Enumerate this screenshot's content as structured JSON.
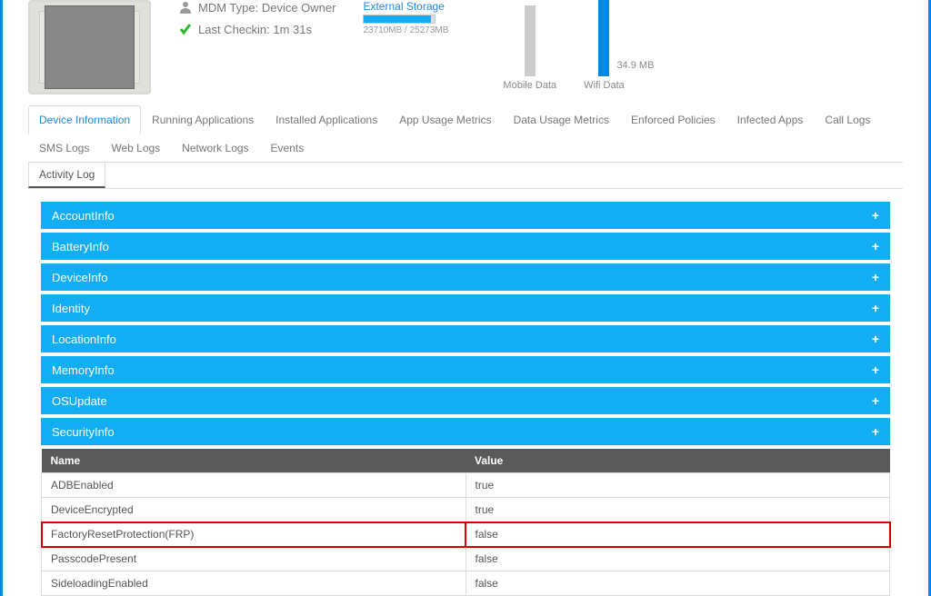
{
  "device": {
    "mdm_type_label": "MDM Type: Device Owner",
    "last_checkin_label": "Last Checkin: 1m 31s"
  },
  "storage": {
    "label": "External Storage",
    "fill_percent": 94,
    "text": "23710MB / 25273MB"
  },
  "mobile_data": {
    "label": "Mobile Data"
  },
  "wifi_data": {
    "label": "Wifi Data",
    "value": "34.9 MB"
  },
  "tabs": [
    "Device Information",
    "Running Applications",
    "Installed Applications",
    "App Usage Metrics",
    "Data Usage Metrics",
    "Enforced Policies",
    "Infected Apps",
    "Call Logs",
    "SMS Logs",
    "Web Logs",
    "Network Logs",
    "Events"
  ],
  "subtab": "Activity Log",
  "accordion": [
    "AccountInfo",
    "BatteryInfo",
    "DeviceInfo",
    "Identity",
    "LocationInfo",
    "MemoryInfo",
    "OSUpdate",
    "SecurityInfo"
  ],
  "table": {
    "headers": {
      "name": "Name",
      "value": "Value"
    },
    "rows": [
      {
        "name": "ADBEnabled",
        "value": "true",
        "highlight": false
      },
      {
        "name": "DeviceEncrypted",
        "value": "true",
        "highlight": false
      },
      {
        "name": "FactoryResetProtection(FRP)",
        "value": "false",
        "highlight": true
      },
      {
        "name": "PasscodePresent",
        "value": "false",
        "highlight": false
      },
      {
        "name": "SideloadingEnabled",
        "value": "false",
        "highlight": false
      }
    ]
  }
}
